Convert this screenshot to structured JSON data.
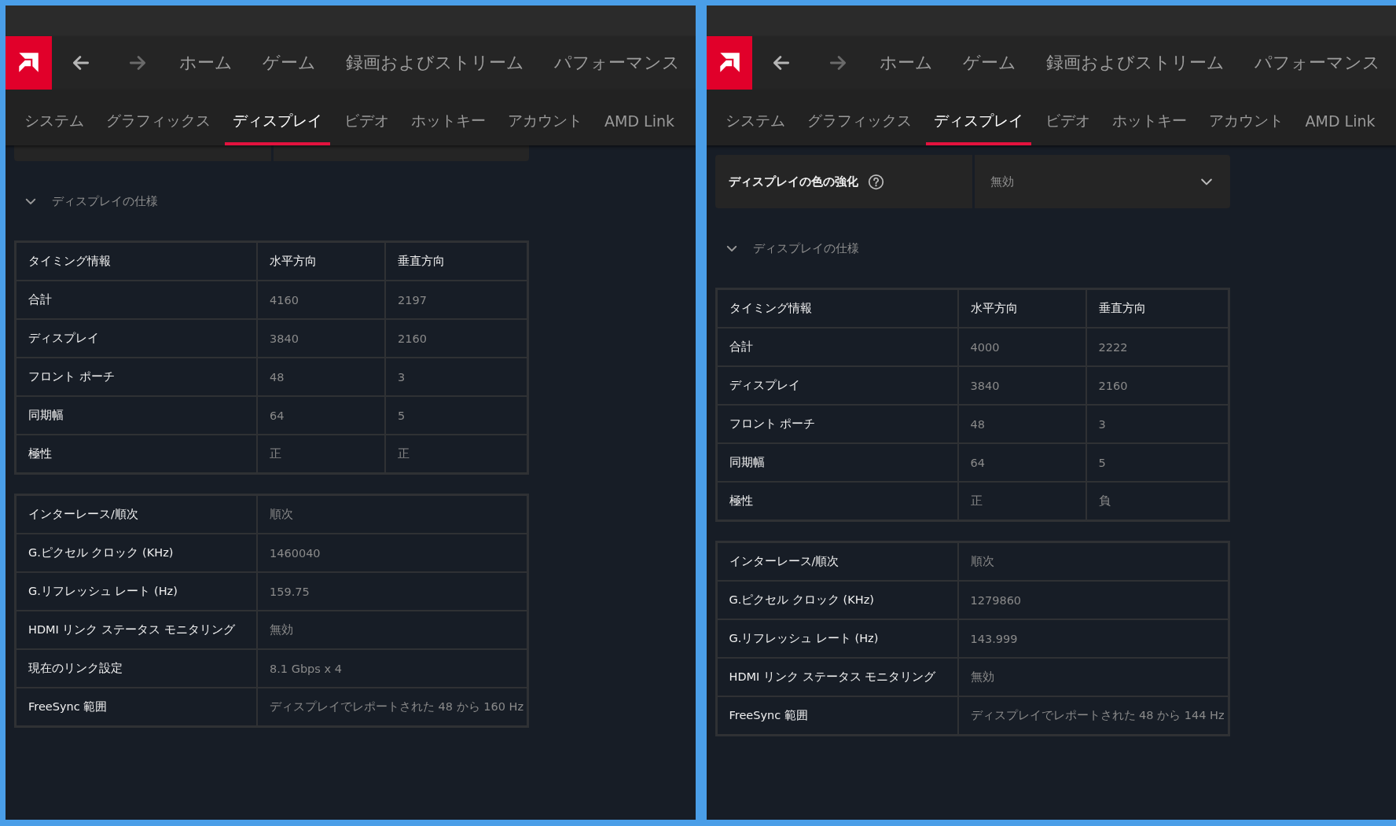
{
  "panels": [
    {
      "nav": {
        "buttons": [
          {
            "kind": "back",
            "disabled": false
          },
          {
            "kind": "forward",
            "disabled": true
          }
        ],
        "items": [
          "ホーム",
          "ゲーム",
          "録画およびストリーム",
          "パフォーマンス"
        ]
      },
      "tabs": [
        {
          "label": "システム",
          "selected": false
        },
        {
          "label": "グラフィックス",
          "selected": false
        },
        {
          "label": "ディスプレイ",
          "selected": true
        },
        {
          "label": "ビデオ",
          "selected": false
        },
        {
          "label": "ホットキー",
          "selected": false
        },
        {
          "label": "アカウント",
          "selected": false
        },
        {
          "label": "AMD Link",
          "selected": false
        }
      ],
      "scrolled": true,
      "section": {
        "title": "ディスプレイの仕様",
        "expanded": true
      },
      "timing_table": {
        "columns": [
          "タイミング情報",
          "水平方向",
          "垂直方向"
        ],
        "rows": [
          [
            "合計",
            "4160",
            "2197"
          ],
          [
            "ディスプレイ",
            "3840",
            "2160"
          ],
          [
            "フロント ポーチ",
            "48",
            "3"
          ],
          [
            "同期幅",
            "64",
            "5"
          ],
          [
            "極性",
            "正",
            "正"
          ]
        ]
      },
      "info_table": {
        "rows": [
          [
            "インターレース/順次",
            "順次"
          ],
          [
            "G.ピクセル クロック (KHz)",
            "1460040"
          ],
          [
            "G.リフレッシュ レート (Hz)",
            "159.75"
          ],
          [
            "HDMI リンク ステータス モニタリング",
            "無効"
          ],
          [
            "現在のリンク設定",
            "8.1 Gbps x 4"
          ],
          [
            "FreeSync 範囲",
            "ディスプレイでレポートされた 48 から 160 Hz"
          ]
        ]
      }
    },
    {
      "nav": {
        "buttons": [
          {
            "kind": "back",
            "disabled": false
          },
          {
            "kind": "forward",
            "disabled": true
          }
        ],
        "items": [
          "ホーム",
          "ゲーム",
          "録画およびストリーム",
          "パフォーマンス"
        ]
      },
      "tabs": [
        {
          "label": "システム",
          "selected": false
        },
        {
          "label": "グラフィックス",
          "selected": false
        },
        {
          "label": "ディスプレイ",
          "selected": true
        },
        {
          "label": "ビデオ",
          "selected": false
        },
        {
          "label": "ホットキー",
          "selected": false
        },
        {
          "label": "アカウント",
          "selected": false
        },
        {
          "label": "AMD Link",
          "selected": false
        }
      ],
      "scrolled": false,
      "setting": {
        "label": "ディスプレイの色の強化",
        "value": "無効"
      },
      "section": {
        "title": "ディスプレイの仕様",
        "expanded": true
      },
      "timing_table": {
        "columns": [
          "タイミング情報",
          "水平方向",
          "垂直方向"
        ],
        "rows": [
          [
            "合計",
            "4000",
            "2222"
          ],
          [
            "ディスプレイ",
            "3840",
            "2160"
          ],
          [
            "フロント ポーチ",
            "48",
            "3"
          ],
          [
            "同期幅",
            "64",
            "5"
          ],
          [
            "極性",
            "正",
            "負"
          ]
        ]
      },
      "info_table": {
        "rows": [
          [
            "インターレース/順次",
            "順次"
          ],
          [
            "G.ピクセル クロック (KHz)",
            "1279860"
          ],
          [
            "G.リフレッシュ レート (Hz)",
            "143.999"
          ],
          [
            "HDMI リンク ステータス モニタリング",
            "無効"
          ],
          [
            "FreeSync 範囲",
            "ディスプレイでレポートされた 48 から 144 Hz"
          ]
        ]
      }
    }
  ]
}
